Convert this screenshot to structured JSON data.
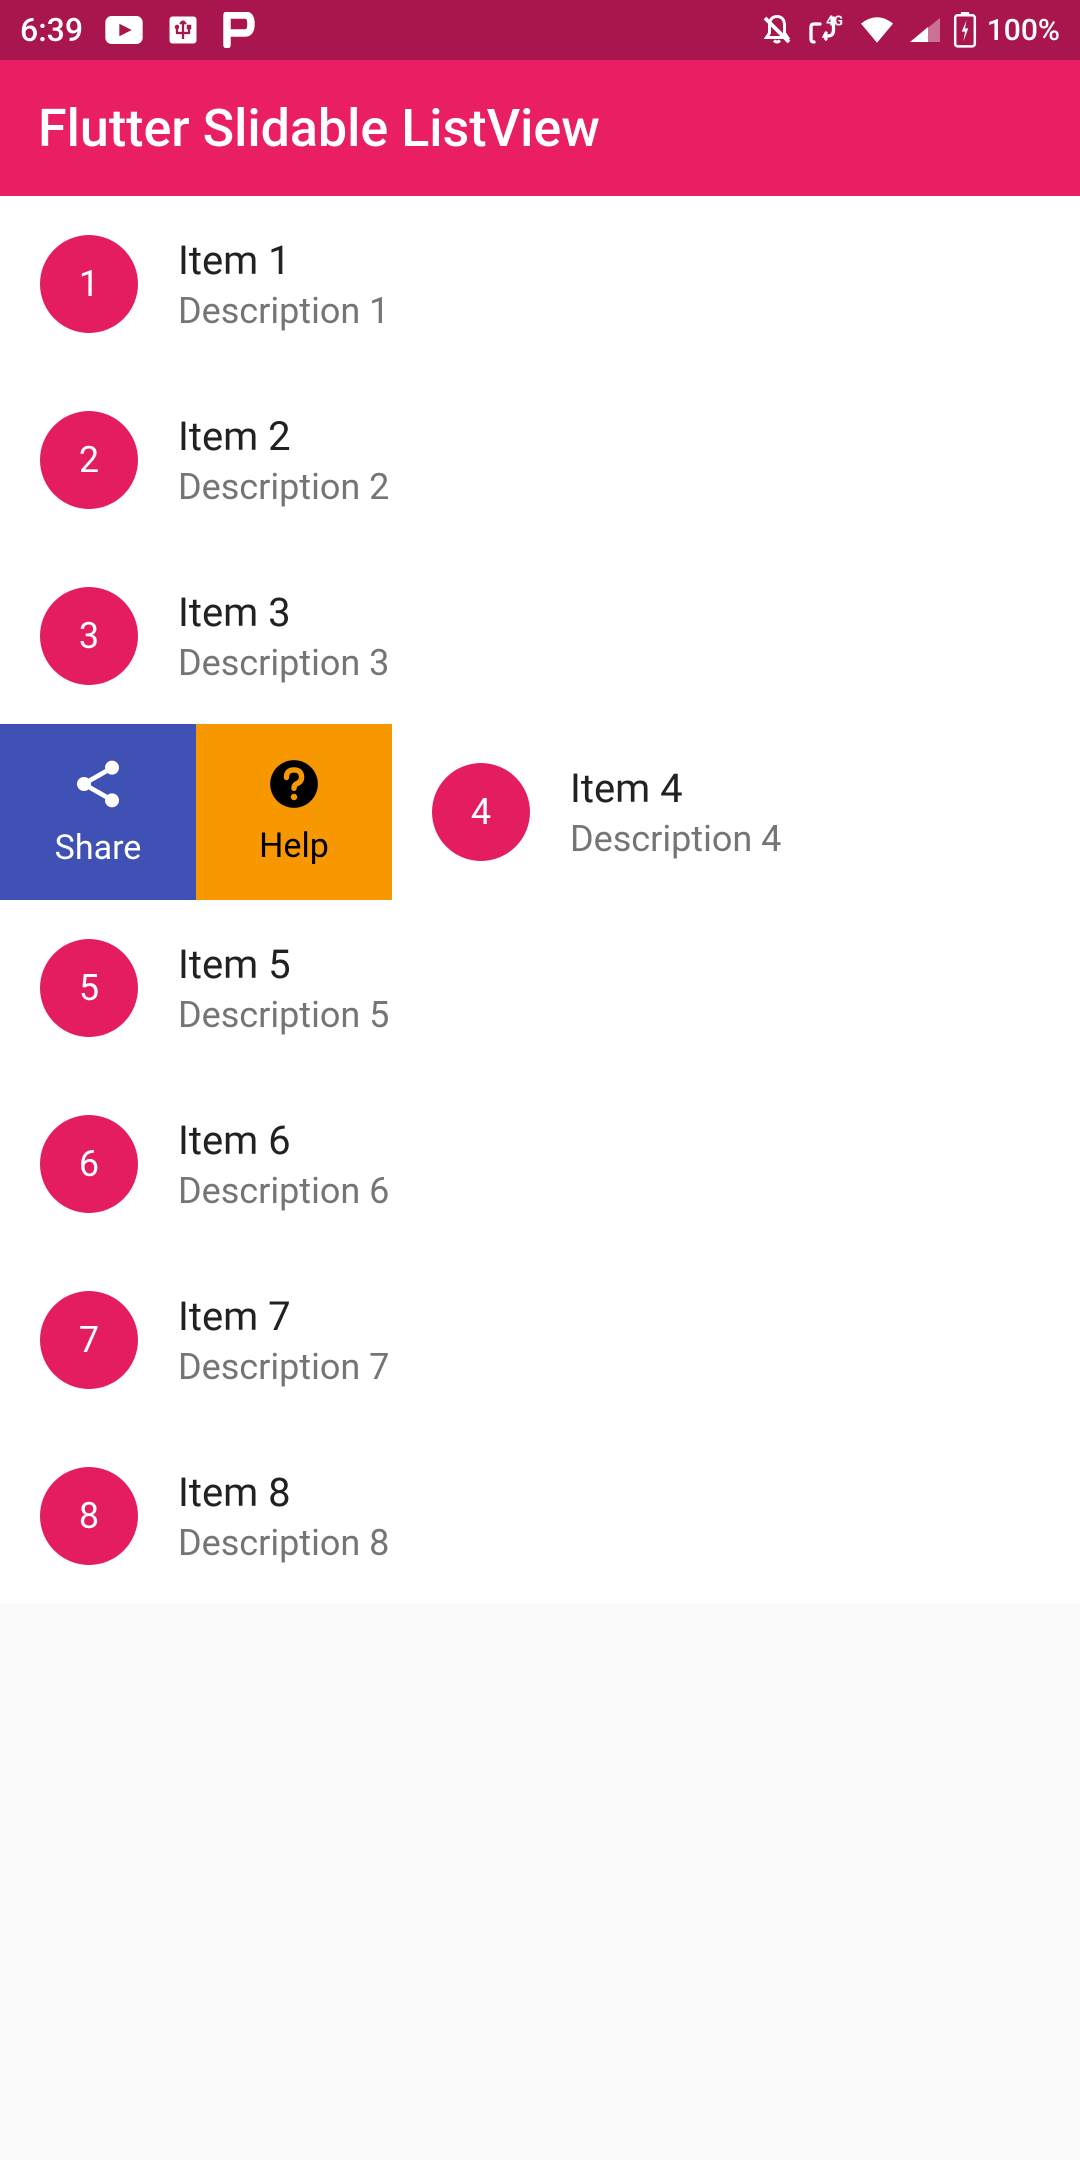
{
  "status_bar": {
    "time": "6:39",
    "battery_percent": "100%"
  },
  "app_bar": {
    "title": "Flutter Slidable ListView"
  },
  "slide_actions": {
    "share": "Share",
    "help": "Help"
  },
  "items": [
    {
      "index": "1",
      "title": "Item 1",
      "desc": "Description 1"
    },
    {
      "index": "2",
      "title": "Item 2",
      "desc": "Description 2"
    },
    {
      "index": "3",
      "title": "Item 3",
      "desc": "Description 3"
    },
    {
      "index": "4",
      "title": "Item 4",
      "desc": "Description 4"
    },
    {
      "index": "5",
      "title": "Item 5",
      "desc": "Description 5"
    },
    {
      "index": "6",
      "title": "Item 6",
      "desc": "Description 6"
    },
    {
      "index": "7",
      "title": "Item 7",
      "desc": "Description 7"
    },
    {
      "index": "8",
      "title": "Item 8",
      "desc": "Description 8"
    }
  ]
}
